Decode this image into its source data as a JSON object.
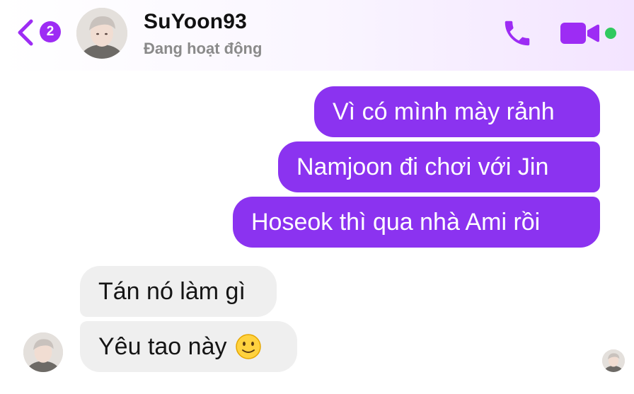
{
  "header": {
    "back_badge": "2",
    "contact_name": "SuYoon93",
    "status": "Đang hoạt động",
    "icons": {
      "back": "chevron-left-icon",
      "call": "phone-icon",
      "video": "video-camera-icon",
      "avatar": "contact-avatar"
    },
    "online": true
  },
  "messages": [
    {
      "direction": "sent",
      "text": "Vì có mình mày rảnh"
    },
    {
      "direction": "sent",
      "text": "Namjoon đi chơi với Jin"
    },
    {
      "direction": "sent",
      "text": "Hoseok thì qua nhà Ami rồi"
    },
    {
      "direction": "received",
      "text": "Tán nó làm gì"
    },
    {
      "direction": "received",
      "text": "Yêu tao này",
      "emoji": "slightly-smiling-face"
    }
  ],
  "colors": {
    "accent": "#9d2cf4",
    "sent_bubble": "#8b33f0",
    "received_bubble": "#efefef",
    "online": "#31c95f"
  }
}
